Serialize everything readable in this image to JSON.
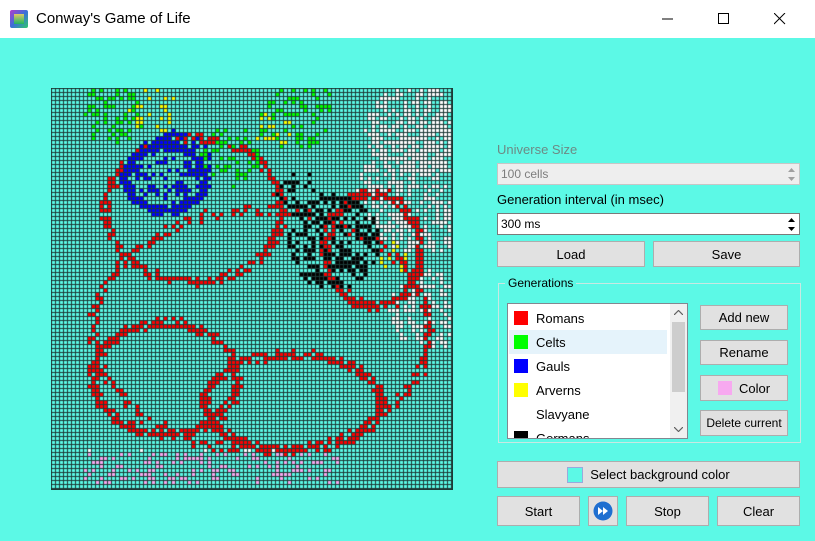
{
  "window": {
    "title": "Conway's Game of Life",
    "background": "#5cf9e6"
  },
  "controls": {
    "universe_size_label": "Universe Size",
    "universe_size_value": "100 cells",
    "interval_label": "Generation interval (in msec)",
    "interval_value": "300 ms",
    "load": "Load",
    "save": "Save",
    "select_bg": "Select background color",
    "start": "Start",
    "stop": "Stop",
    "clear": "Clear"
  },
  "generations": {
    "title": "Generations",
    "items": [
      {
        "name": "Romans",
        "color": "#ff0000"
      },
      {
        "name": "Celts",
        "color": "#00ff00"
      },
      {
        "name": "Gauls",
        "color": "#0000ff"
      },
      {
        "name": "Arverns",
        "color": "#ffff00"
      },
      {
        "name": "Slavyane",
        "color": "#ffffff"
      },
      {
        "name": "Germans",
        "color": "#000000"
      }
    ],
    "selected_index": 1,
    "add_new": "Add new",
    "rename": "Rename",
    "color": "Color",
    "color_swatch": "#f7a9f0",
    "delete": "Delete current"
  },
  "background_color": "#5cf9e6",
  "grid_line_color": "#1d3a37",
  "grid_cells": 100
}
